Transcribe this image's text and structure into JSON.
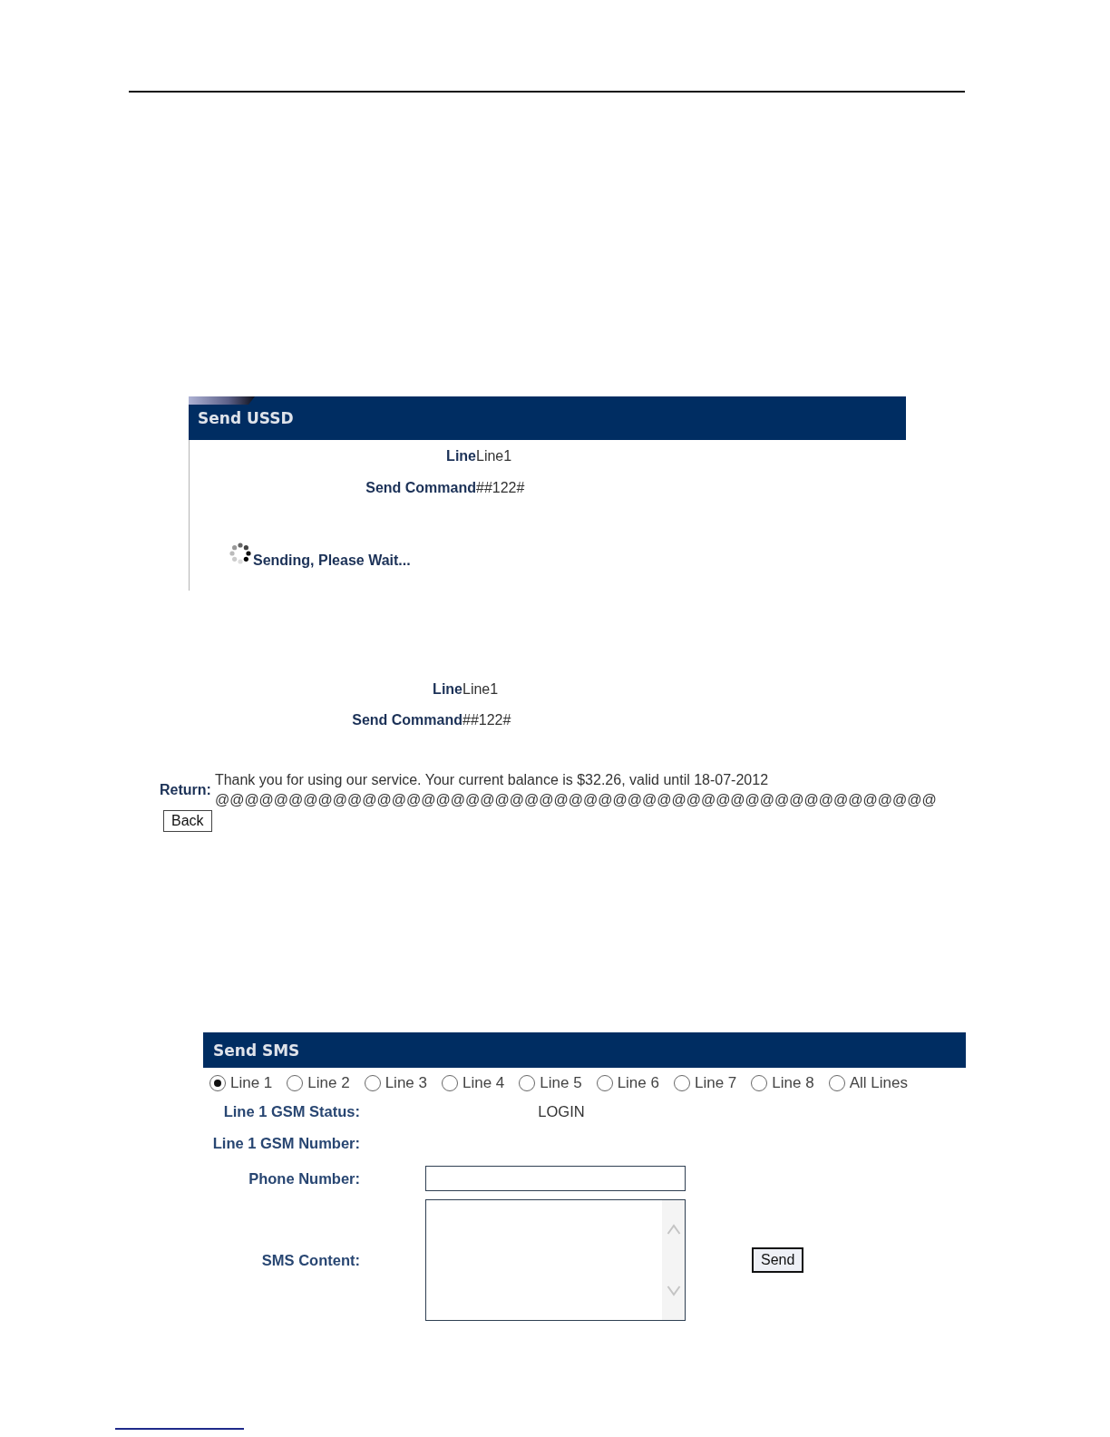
{
  "ussd_sending": {
    "title": "Send USSD",
    "fields": [
      {
        "label": "Line",
        "value": "Line1"
      },
      {
        "label": "Send Command",
        "value": "##122#"
      }
    ],
    "status": {
      "kind": "loading",
      "text": "Sending, Please Wait..."
    }
  },
  "ussd_result": {
    "fields": [
      {
        "label": "Line",
        "value": "Line1"
      },
      {
        "label": "Send Command",
        "value": "##122#"
      }
    ],
    "return": {
      "label": "Return:",
      "message": "Thank you for using our service. Your current balance is $32.26, valid until 18-07-2012 @@@@@@@@@@@@@@@@@@@@@@@@@@@@@@@@@@@@@@@@@@@@@@@@@"
    },
    "back_button": "Back"
  },
  "sms": {
    "title": "Send SMS",
    "lines": [
      {
        "label": "Line 1",
        "selected": true
      },
      {
        "label": "Line 2",
        "selected": false
      },
      {
        "label": "Line 3",
        "selected": false
      },
      {
        "label": "Line 4",
        "selected": false
      },
      {
        "label": "Line 5",
        "selected": false
      },
      {
        "label": "Line 6",
        "selected": false
      },
      {
        "label": "Line 7",
        "selected": false
      },
      {
        "label": "Line 8",
        "selected": false
      },
      {
        "label": "All Lines",
        "selected": false
      }
    ],
    "rows": [
      {
        "kind": "text",
        "label": "Line 1 GSM Status:",
        "value": "LOGIN"
      },
      {
        "kind": "text",
        "label": "Line 1 GSM Number:"
      },
      {
        "kind": "input",
        "label": "Phone Number:"
      },
      {
        "kind": "textarea",
        "label": "SMS Content:"
      }
    ],
    "send_button": "Send"
  }
}
